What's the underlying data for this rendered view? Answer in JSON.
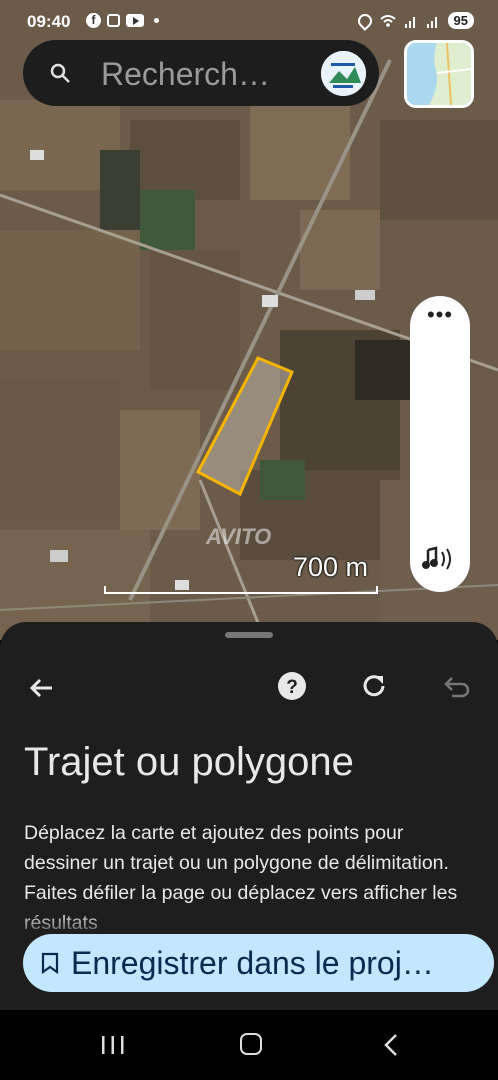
{
  "status_bar": {
    "time": "09:40",
    "battery": "95",
    "icons": [
      "facebook-icon",
      "scan-icon",
      "youtube-icon",
      "dot-icon",
      "location-icon",
      "wifi-icon",
      "signal-icon",
      "signal-icon"
    ]
  },
  "search": {
    "placeholder": "Recherch…"
  },
  "map": {
    "scale_label": "700 m",
    "watermark": "AVITO",
    "polygon_color": "#f5b400"
  },
  "side_controls": {
    "more_label": "•••",
    "icons": [
      "more-icon",
      "sound-icon"
    ]
  },
  "sheet": {
    "title": "Trajet ou polygone",
    "body": "Déplacez la carte et ajoutez des points pour dessiner un trajet ou un polygone de délimitation. Faites défiler la page ou déplacez vers afficher les résultats",
    "icons": [
      "back-arrow-icon",
      "help-icon",
      "redo-icon",
      "undo-icon"
    ]
  },
  "save_button": {
    "label": "Enregistrer dans le proj…",
    "icon": "bookmark-icon"
  },
  "nav_bar": {
    "icons": [
      "recents-icon",
      "home-icon",
      "back-icon"
    ]
  },
  "colors": {
    "sheet_bg": "#1e1e1e",
    "save_button_bg": "#c3e7ff",
    "save_button_text": "#0b2a52",
    "search_bg": "#1d1d1d"
  }
}
